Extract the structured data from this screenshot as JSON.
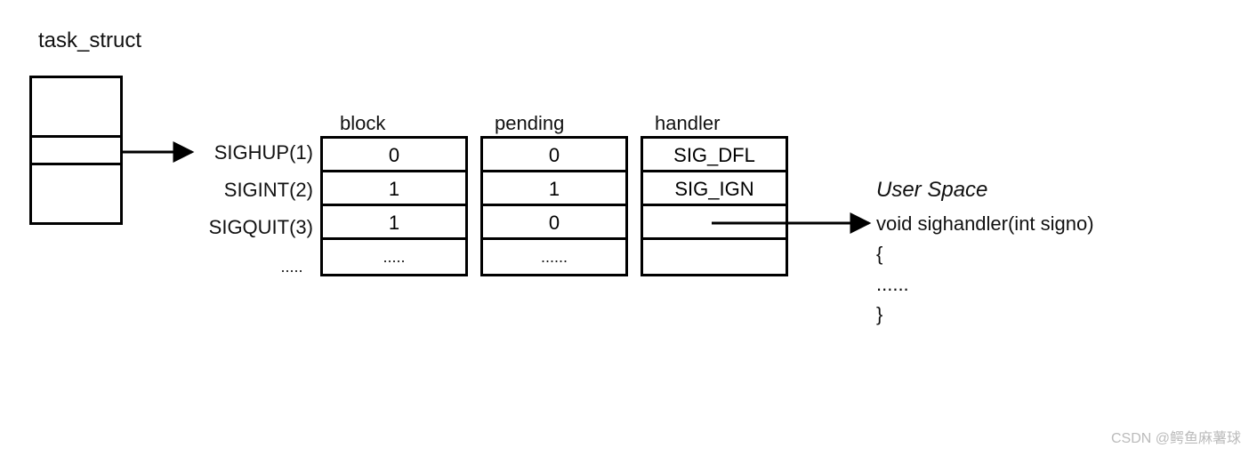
{
  "title": "task_struct",
  "signals": {
    "row1": "SIGHUP(1)",
    "row2": "SIGINT(2)",
    "row3": "SIGQUIT(3)",
    "dots": "....."
  },
  "columns": {
    "block": {
      "header": "block",
      "rows": [
        "0",
        "1",
        "1"
      ],
      "dots": "....."
    },
    "pending": {
      "header": "pending",
      "rows": [
        "0",
        "1",
        "0"
      ],
      "dots": "......"
    },
    "handler": {
      "header": "handler",
      "rows": [
        "SIG_DFL",
        "SIG_IGN",
        ""
      ],
      "dots": ""
    }
  },
  "userspace": {
    "title": "User Space",
    "line1": "void sighandler(int signo)",
    "line2": "{",
    "line3": "......",
    "line4": "}"
  },
  "watermark": "CSDN @鳄鱼麻薯球"
}
